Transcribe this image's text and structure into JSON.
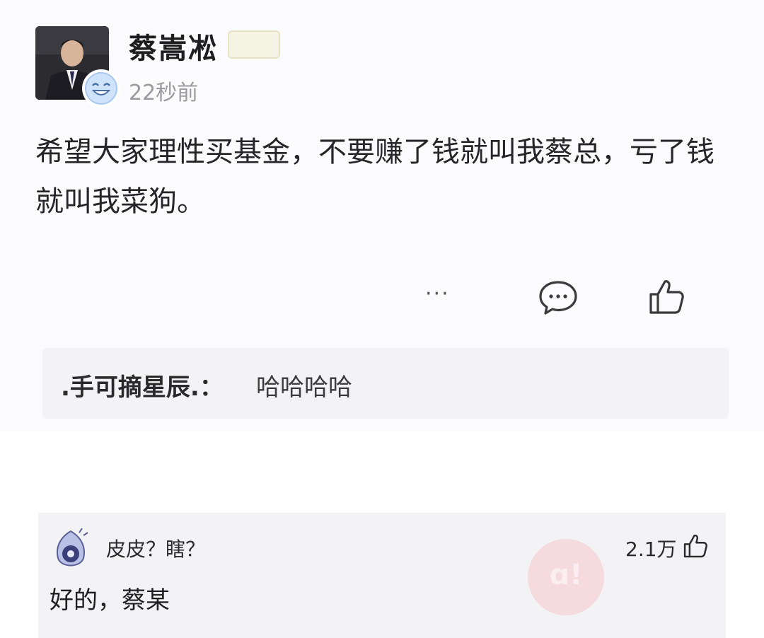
{
  "post": {
    "author": "蔡嵩凇",
    "tag": "",
    "time": "22秒前",
    "content": "希望大家理性买基金，不要赚了钱就叫我蔡总，亏了钱就叫我菜狗。",
    "more_label": "···"
  },
  "reply": {
    "name": ".手可摘星辰.：",
    "text": "哈哈哈哈"
  },
  "comment": {
    "name": "皮皮？瞎？",
    "likes": "2.1万",
    "text": "好的，蔡某"
  },
  "icons": {
    "comment": "comment-bubble-icon",
    "like": "thumbs-up-icon"
  },
  "colors": {
    "time": "#9b9b9b",
    "reply_bg": "#f3f3f6",
    "watermark": "#f6d8dc"
  }
}
